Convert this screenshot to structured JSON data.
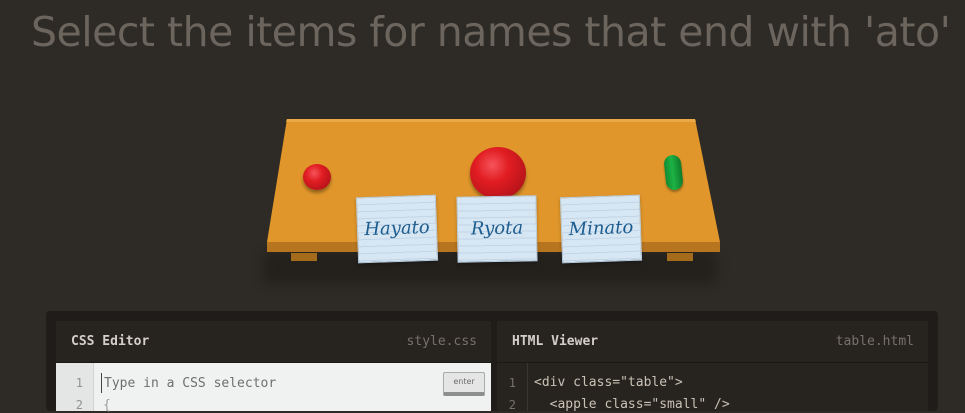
{
  "instruction": "Select the items for names that end with 'ato'",
  "table": {
    "plates": [
      {
        "kind": "small-red-plate"
      },
      {
        "kind": "large-red-plate"
      }
    ],
    "pickle": {
      "kind": "pickle"
    },
    "notes": [
      {
        "name": "Hayato"
      },
      {
        "name": "Ryota"
      },
      {
        "name": "Minato"
      }
    ]
  },
  "css_editor": {
    "title": "CSS Editor",
    "file": "style.css",
    "placeholder": "Type in a CSS selector",
    "line_numbers": [
      "1",
      "2"
    ],
    "line2": "{",
    "enter_label": "enter"
  },
  "html_viewer": {
    "title": "HTML Viewer",
    "file": "table.html",
    "line_numbers": [
      "1",
      "2"
    ],
    "lines": [
      "<div class=\"table\">",
      "  <apple class=\"small\" />"
    ]
  },
  "colors": {
    "background": "#2e2a25",
    "table": "#e0962a",
    "plate": "#e11d22",
    "pickle": "#1db344",
    "note": "#d6e6f2"
  }
}
